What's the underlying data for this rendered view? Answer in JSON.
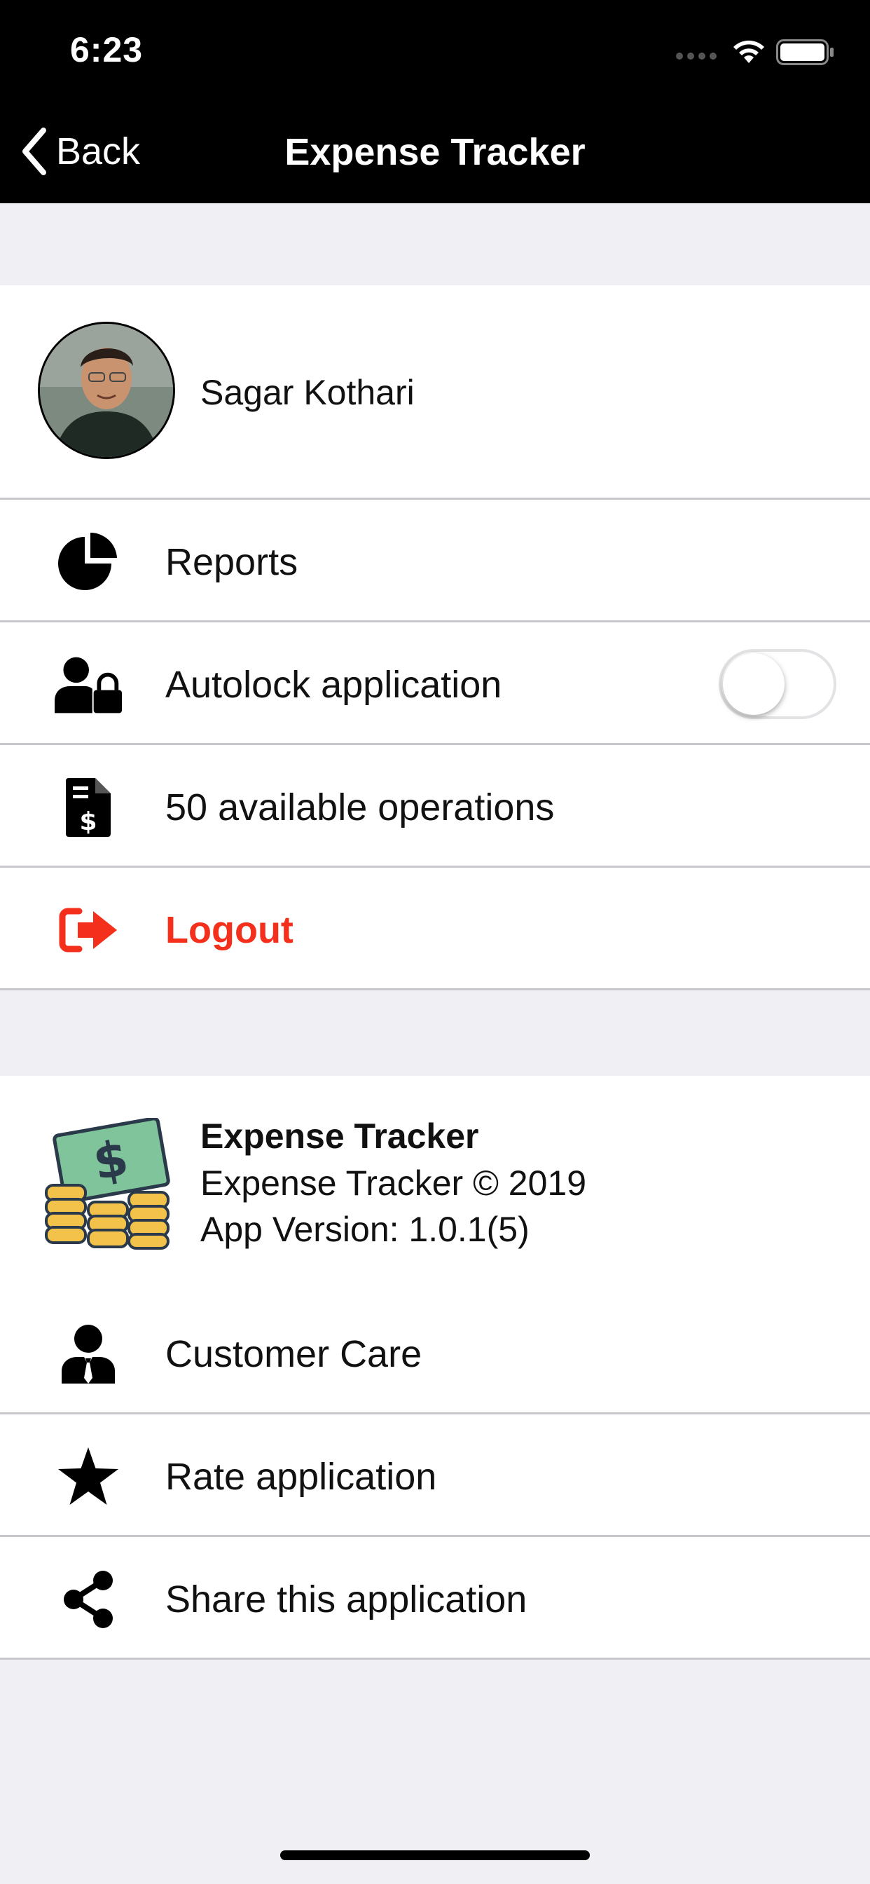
{
  "status": {
    "time": "6:23"
  },
  "nav": {
    "back_label": "Back",
    "title": "Expense Tracker"
  },
  "profile": {
    "name": "Sagar Kothari"
  },
  "menu": {
    "reports": "Reports",
    "autolock": "Autolock application",
    "autolock_enabled": false,
    "operations": "50 available operations",
    "logout": "Logout"
  },
  "about": {
    "title": "Expense Tracker",
    "copyright": "Expense Tracker © 2019",
    "version": "App Version: 1.0.1(5)"
  },
  "support": {
    "customer_care": "Customer Care",
    "rate": "Rate application",
    "share": "Share this application"
  },
  "colors": {
    "accent_red": "#f4301c",
    "nav_bg": "#000000",
    "page_bg": "#efeff4",
    "separator": "#c8c7cc"
  },
  "icons": [
    "back-chevron-icon",
    "wifi-icon",
    "battery-icon",
    "pie-chart-icon",
    "user-lock-icon",
    "invoice-dollar-icon",
    "sign-out-icon",
    "money-coins-icon",
    "user-tie-icon",
    "star-icon",
    "share-icon"
  ]
}
